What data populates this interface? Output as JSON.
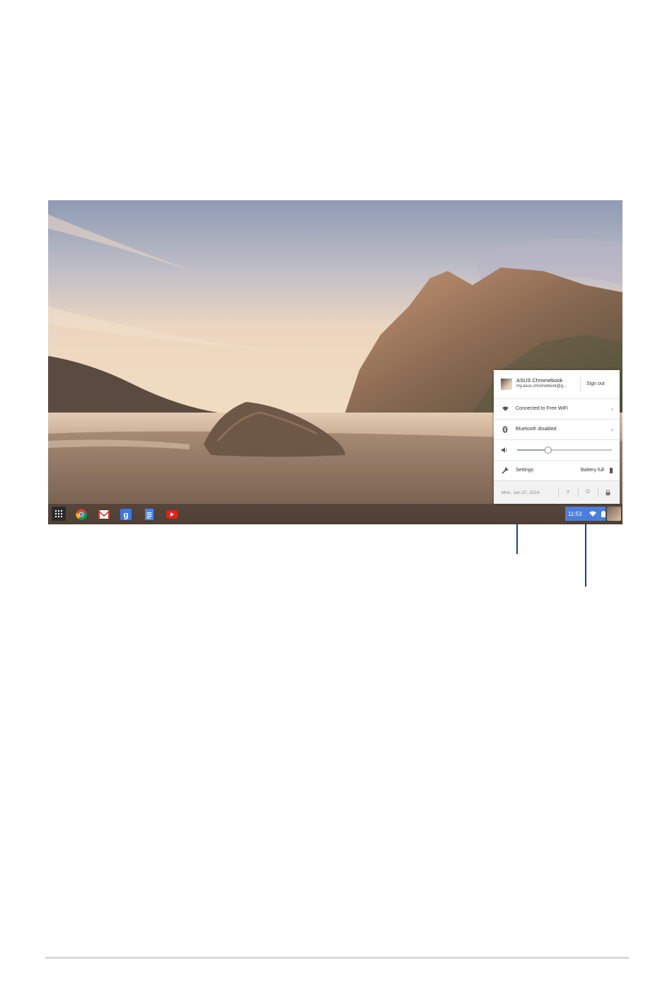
{
  "shelf": {
    "apps": [
      {
        "name": "Launcher"
      },
      {
        "name": "Chrome"
      },
      {
        "name": "Gmail"
      },
      {
        "name": "Google Search"
      },
      {
        "name": "Docs"
      },
      {
        "name": "YouTube"
      }
    ],
    "clock": "11:53"
  },
  "tray": {
    "user": {
      "name": "ASUS Chromebook",
      "email": "my.asus.chromebook@g...",
      "sign_out": "Sign out"
    },
    "network": {
      "label": "Connected to Free WiFi"
    },
    "bluetooth": {
      "label": "Bluetooth disabled"
    },
    "volume": {
      "level": 0.33
    },
    "settings": {
      "label": "Settings",
      "battery": "Battery full"
    },
    "footer": {
      "date": "Mon, Jan 27, 2014",
      "help": "?",
      "power": "⏻"
    }
  },
  "colors": {
    "status_accent": "#4a7ee0",
    "callout_line": "#1d3f8a"
  }
}
